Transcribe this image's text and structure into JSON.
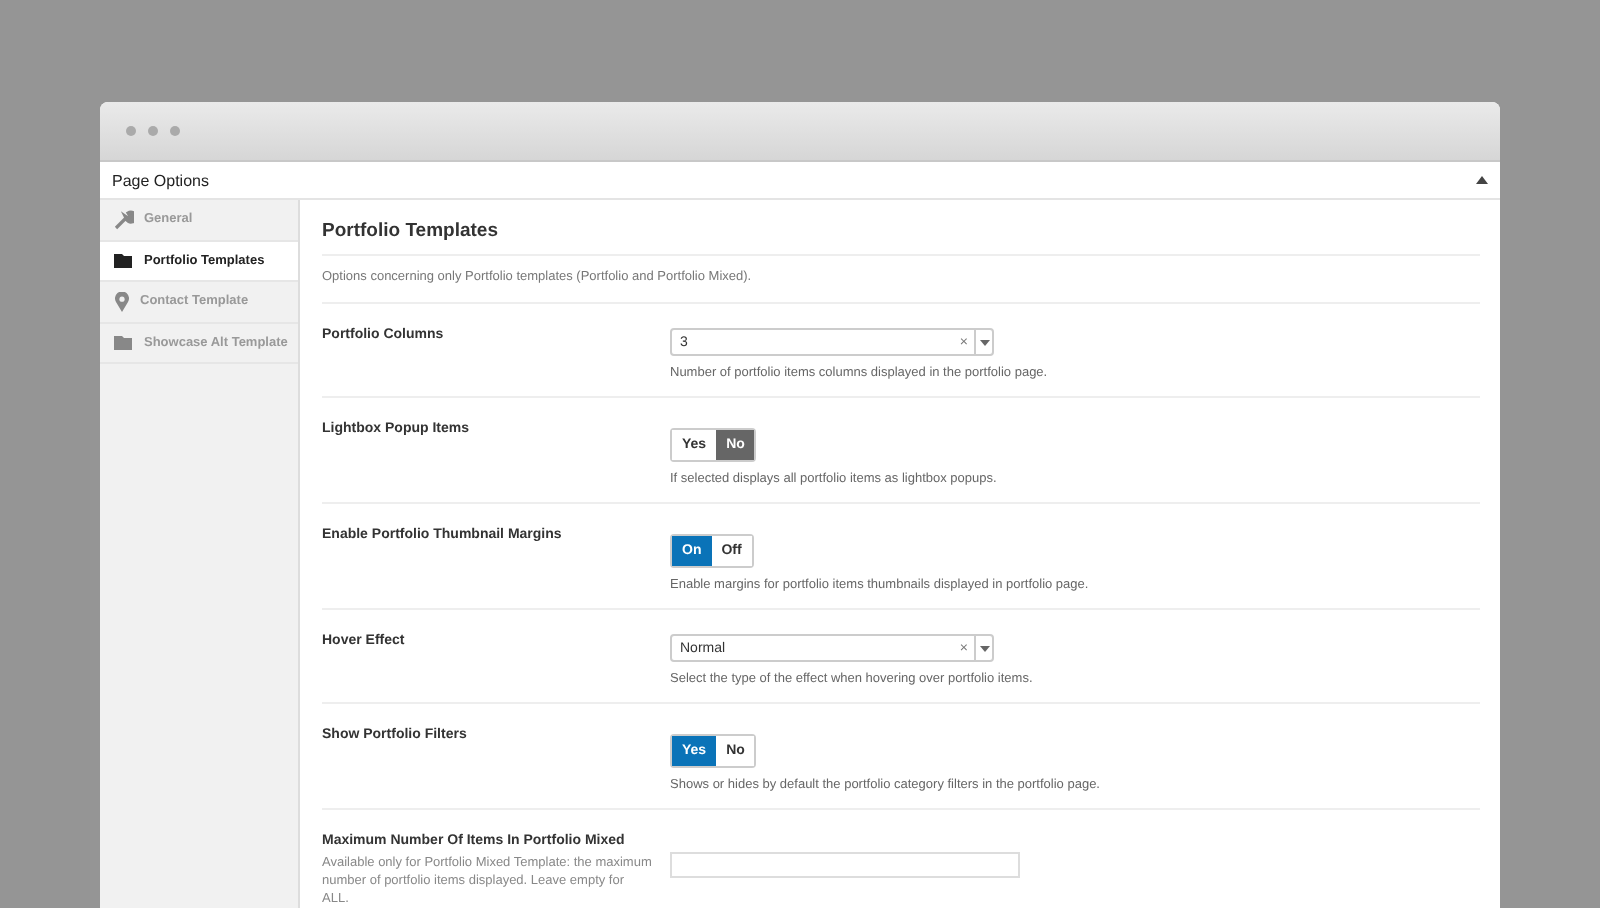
{
  "window": {
    "title": "Page Options"
  },
  "sidebar": {
    "items": [
      {
        "label": "General",
        "kind": "wrench",
        "selected": false
      },
      {
        "label": "Portfolio Templates",
        "kind": "folder",
        "selected": true
      },
      {
        "label": "Contact Template",
        "kind": "pin",
        "selected": false
      },
      {
        "label": "Showcase Alt Template",
        "kind": "folder",
        "selected": false
      }
    ]
  },
  "section": {
    "title": "Portfolio Templates",
    "description": "Options concerning only Portfolio templates (Portfolio and Portfolio Mixed)."
  },
  "options": [
    {
      "kind": "select",
      "label": "Portfolio Columns",
      "value": "3",
      "clear": "×",
      "help": "Number of portfolio items columns displayed in the portfolio page."
    },
    {
      "kind": "toggle",
      "label": "Lightbox Popup Items",
      "choices": [
        {
          "label": "Yes",
          "selected": false
        },
        {
          "label": "No",
          "selected": true
        }
      ],
      "help": "If selected displays all portfolio items as lightbox popups."
    },
    {
      "kind": "toggle",
      "label": "Enable Portfolio Thumbnail Margins",
      "choices": [
        {
          "label": "On",
          "selected": true
        },
        {
          "label": "Off",
          "selected": false
        }
      ],
      "help": "Enable margins for portfolio items thumbnails displayed in portfolio page."
    },
    {
      "kind": "select",
      "label": "Hover Effect",
      "value": "Normal",
      "clear": "×",
      "help": "Select the type of the effect when hovering over portfolio items."
    },
    {
      "kind": "toggle",
      "label": "Show Portfolio Filters",
      "choices": [
        {
          "label": "Yes",
          "selected": true
        },
        {
          "label": "No",
          "selected": false
        }
      ],
      "help": "Shows or hides by default the portfolio category filters in the portfolio page."
    },
    {
      "kind": "text",
      "label": "Maximum Number Of Items In Portfolio Mixed",
      "note": "Available only for Portfolio Mixed Template: the maximum number of portfolio items displayed. Leave empty for ALL."
    }
  ]
}
